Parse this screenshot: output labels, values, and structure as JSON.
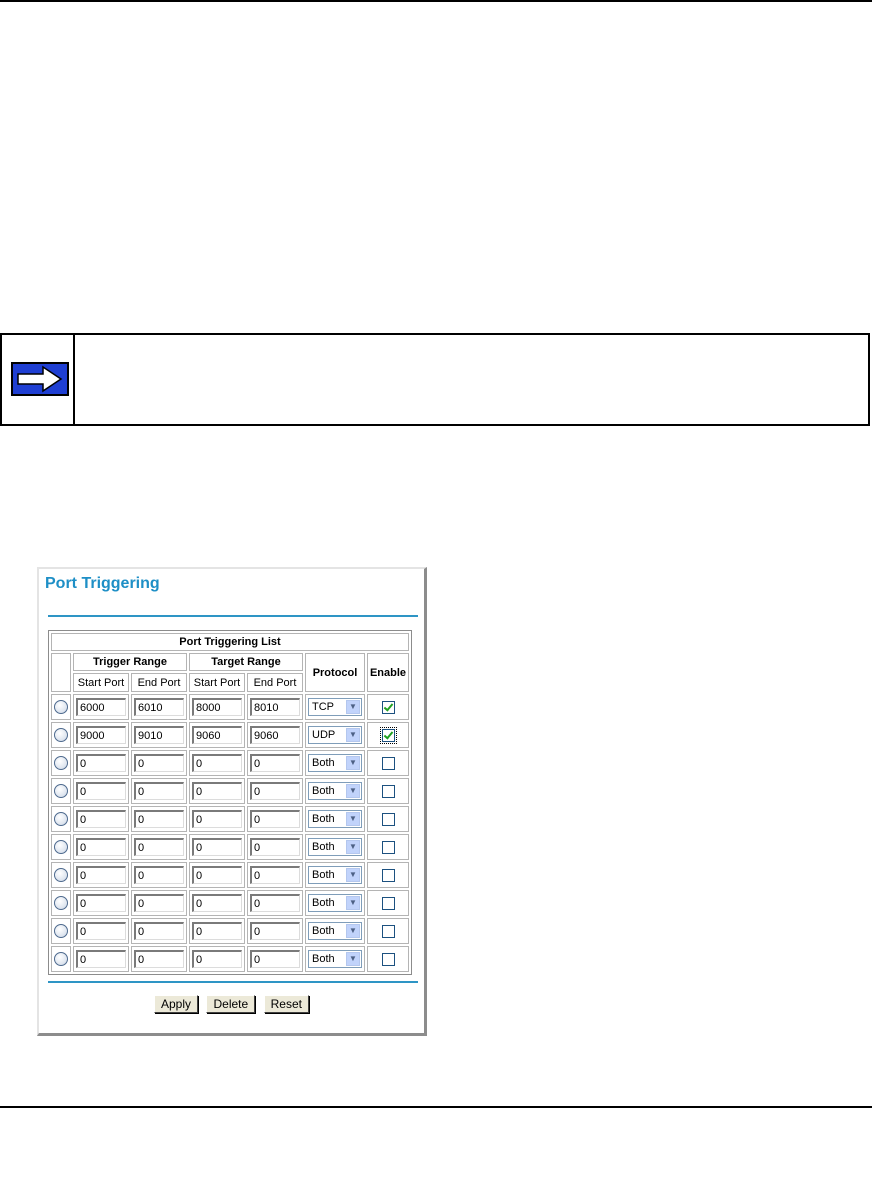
{
  "panel": {
    "title": "Port Triggering",
    "list_title": "Port Triggering List",
    "headers": {
      "trigger_range": "Trigger Range",
      "target_range": "Target Range",
      "protocol": "Protocol",
      "enable": "Enable",
      "start_port": "Start Port",
      "end_port": "End Port"
    },
    "rows": [
      {
        "trigger_start": "6000",
        "trigger_end": "6010",
        "target_start": "8000",
        "target_end": "8010",
        "protocol": "TCP",
        "enabled": true
      },
      {
        "trigger_start": "9000",
        "trigger_end": "9010",
        "target_start": "9060",
        "target_end": "9060",
        "protocol": "UDP",
        "enabled": true
      },
      {
        "trigger_start": "0",
        "trigger_end": "0",
        "target_start": "0",
        "target_end": "0",
        "protocol": "Both",
        "enabled": false
      },
      {
        "trigger_start": "0",
        "trigger_end": "0",
        "target_start": "0",
        "target_end": "0",
        "protocol": "Both",
        "enabled": false
      },
      {
        "trigger_start": "0",
        "trigger_end": "0",
        "target_start": "0",
        "target_end": "0",
        "protocol": "Both",
        "enabled": false
      },
      {
        "trigger_start": "0",
        "trigger_end": "0",
        "target_start": "0",
        "target_end": "0",
        "protocol": "Both",
        "enabled": false
      },
      {
        "trigger_start": "0",
        "trigger_end": "0",
        "target_start": "0",
        "target_end": "0",
        "protocol": "Both",
        "enabled": false
      },
      {
        "trigger_start": "0",
        "trigger_end": "0",
        "target_start": "0",
        "target_end": "0",
        "protocol": "Both",
        "enabled": false
      },
      {
        "trigger_start": "0",
        "trigger_end": "0",
        "target_start": "0",
        "target_end": "0",
        "protocol": "Both",
        "enabled": false
      },
      {
        "trigger_start": "0",
        "trigger_end": "0",
        "target_start": "0",
        "target_end": "0",
        "protocol": "Both",
        "enabled": false
      }
    ],
    "buttons": {
      "apply": "Apply",
      "delete": "Delete",
      "reset": "Reset"
    }
  },
  "note": {
    "icon": "right-arrow-icon"
  },
  "colors": {
    "title": "#1e8fc6",
    "accent_bar": "#2e95c5",
    "note_arrow": "#1f3fd3"
  }
}
